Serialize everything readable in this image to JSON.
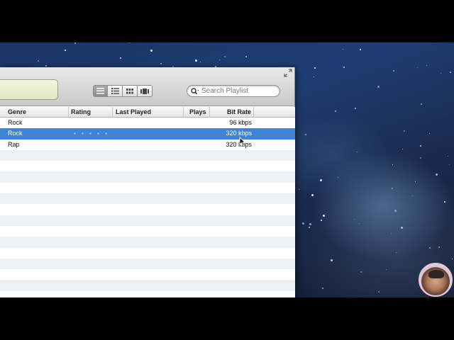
{
  "toolbar": {
    "search_placeholder": "Search Playlist",
    "view_buttons": [
      "list-view",
      "album-list-view",
      "grid-view",
      "cover-flow-view"
    ]
  },
  "columns": [
    "Genre",
    "Rating",
    "Last Played",
    "Plays",
    "Bit Rate"
  ],
  "tracks": [
    {
      "genre": "Rock",
      "rating": "",
      "last_played": "",
      "plays": "",
      "bit_rate": "96 kbps",
      "selected": false
    },
    {
      "genre": "Rock",
      "rating": "• • • • •",
      "last_played": "",
      "plays": "",
      "bit_rate": "320 kbps",
      "selected": true
    },
    {
      "genre": "Rap",
      "rating": "",
      "last_played": "",
      "plays": "",
      "bit_rate": "320 kbps",
      "selected": false
    }
  ],
  "colors": {
    "selection": "#3e83d6",
    "stripe": "#eef1f4",
    "lcd": "#eef0d2"
  }
}
